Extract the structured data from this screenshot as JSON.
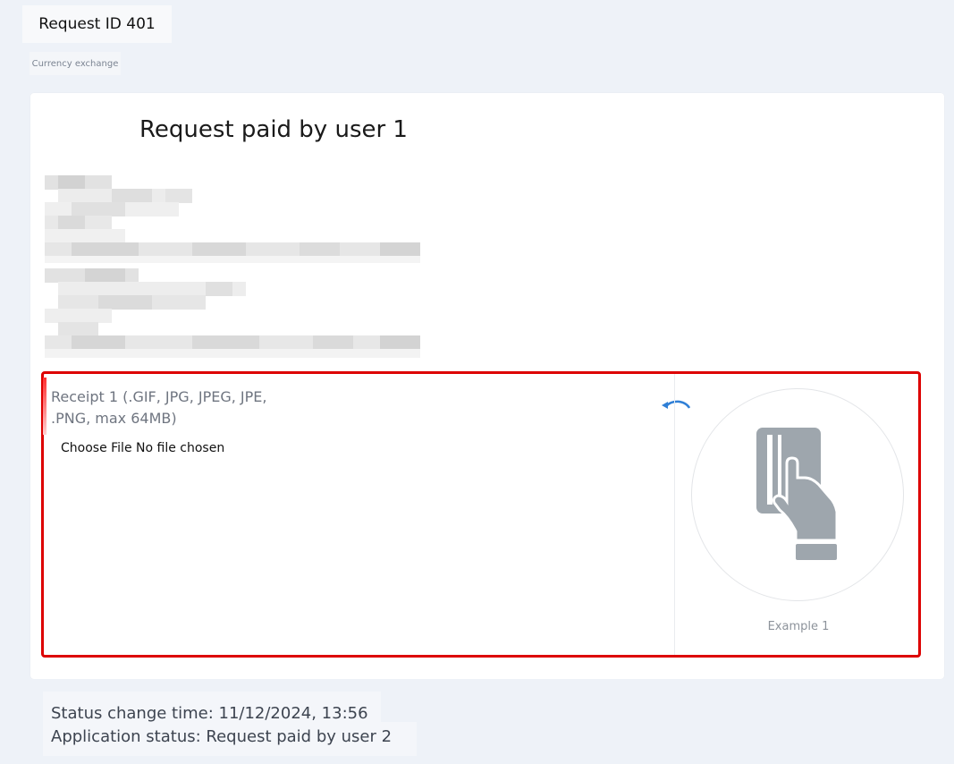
{
  "header": {
    "request_id": "Request ID 401",
    "category": "Currency exchange"
  },
  "card": {
    "title": "Request paid by user 1"
  },
  "upload": {
    "label": "Receipt 1 (.GIF, JPG, JPEG, JPE, .PNG, max 64MB)",
    "choose_file": "Choose File",
    "no_file": "No file chosen",
    "example_label": "Example 1",
    "icons": [
      "rotate-icon",
      "card-in-hand-icon"
    ]
  },
  "status": {
    "change_time": "Status change time: 11/12/2024, 13:56",
    "application_status": "Application status: Request paid by user 2"
  },
  "colors": {
    "highlight_border": "#dd0000",
    "rotate_icon": "#2f7fd6",
    "illustration": "#9ea6ad",
    "page_bg": "#eef2f8"
  }
}
